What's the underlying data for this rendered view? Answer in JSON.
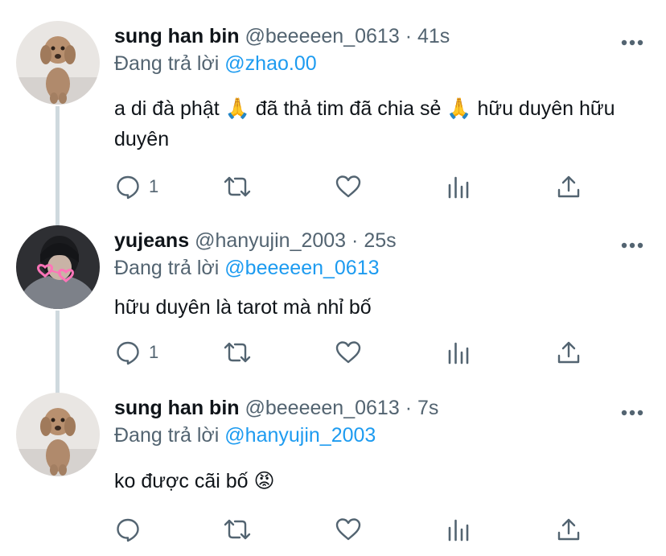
{
  "tweets": [
    {
      "name": "sung han bin",
      "handle": "@beeeeen_0613",
      "separator": "·",
      "time": "41s",
      "replying_prefix": "Đang trả lời",
      "replying_to": "@zhao.00",
      "text_parts": [
        "a di đà phật ",
        "🙏",
        "  đã thả tim đã chia sẻ ",
        "🙏",
        "  hữu duyên hữu duyên"
      ],
      "reply_count": "1",
      "avatar_icon": "poodle-photo"
    },
    {
      "name": "yujeans",
      "handle": "@hanyujin_2003",
      "separator": "·",
      "time": "25s",
      "replying_prefix": "Đang trả lời",
      "replying_to": "@beeeeen_0613",
      "text": "hữu duyên là tarot mà nhỉ bố",
      "reply_count": "1",
      "avatar_icon": "person-heart-glasses-photo"
    },
    {
      "name": "sung han bin",
      "handle": "@beeeeen_0613",
      "separator": "·",
      "time": "7s",
      "replying_prefix": "Đang trả lời",
      "replying_to": "@hanyujin_2003",
      "text": "ko được cãi bố",
      "emoji": "😡",
      "reply_count": "",
      "avatar_icon": "poodle-photo"
    }
  ],
  "icons": {
    "reply": "reply-icon",
    "retweet": "retweet-icon",
    "like": "heart-icon",
    "views": "views-icon",
    "share": "share-icon",
    "more": "more-icon"
  },
  "colors": {
    "text": "#0f1419",
    "secondary": "#536471",
    "link": "#1d9bf0",
    "thread_line": "#cfd9de"
  }
}
